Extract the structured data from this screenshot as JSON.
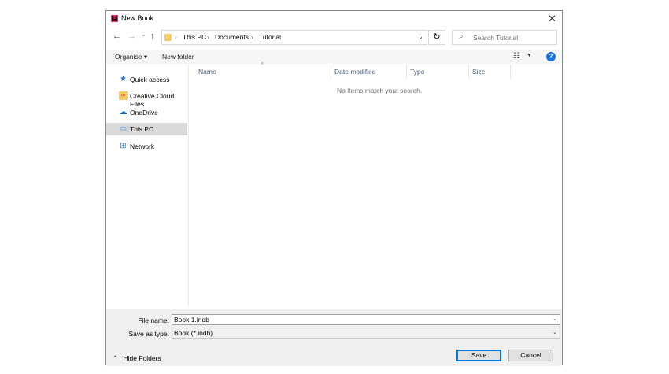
{
  "window": {
    "title": "New Book",
    "app_icon_text": "ID",
    "close": "✕"
  },
  "nav": {
    "back": "←",
    "forward": "→",
    "recent": "⌄",
    "up": "↑",
    "breadcrumbs": [
      "This PC",
      "Documents",
      "Tutorial"
    ],
    "separator": "›",
    "refresh": "↻",
    "search_placeholder": "Search Tutorial"
  },
  "toolbar": {
    "organise": "Organise ▾",
    "new_folder": "New folder",
    "help": "?"
  },
  "sidebar": {
    "items": [
      {
        "label": "Quick access",
        "icon": "star-icon"
      },
      {
        "label": "Creative Cloud Files",
        "icon": "creative-cloud-icon"
      },
      {
        "label": "OneDrive",
        "icon": "cloud-icon"
      },
      {
        "label": "This PC",
        "icon": "computer-icon",
        "selected": true
      },
      {
        "label": "Network",
        "icon": "network-icon"
      }
    ]
  },
  "columns": [
    "Name",
    "Date modified",
    "Type",
    "Size"
  ],
  "empty_message": "No items match your search.",
  "footer": {
    "file_name_label": "File name:",
    "file_name_value": "Book 1.indb",
    "save_type_label": "Save as type:",
    "save_type_value": "Book (*.indb)",
    "hide_folders": "Hide Folders",
    "save": "Save",
    "cancel": "Cancel"
  },
  "colors": {
    "accent": "#0078d7",
    "selected_bg": "#d9d9d9",
    "column_header": "#4c607a"
  }
}
